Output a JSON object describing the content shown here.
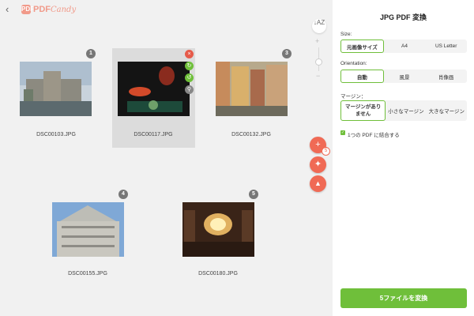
{
  "header": {
    "back_icon": "chevron-left-icon",
    "logo_mark": "PDF",
    "logo_text": "PDF",
    "logo_text_italic": "Candy",
    "brand_color": "#f19a8a"
  },
  "toolbar": {
    "sort_glyph": "↓AZ",
    "zoom_plus": "+",
    "zoom_minus": "−",
    "zoom_level": 0.5
  },
  "side_actions": [
    {
      "name": "add-file",
      "glyph": "+",
      "count": "5"
    },
    {
      "name": "dropbox",
      "glyph": "✦"
    },
    {
      "name": "google-drive",
      "glyph": "▲"
    }
  ],
  "files": [
    {
      "index": "1",
      "name": "DSC00103.JPG"
    },
    {
      "index": "2",
      "name": "DSC00117.JPG"
    },
    {
      "index": "3",
      "name": "DSC00132.JPG"
    },
    {
      "index": "4",
      "name": "DSC00155.JPG"
    },
    {
      "index": "5",
      "name": "DSC00180.JPG"
    }
  ],
  "file_actions": {
    "delete": "×",
    "rotate_right": "↻",
    "rotate_left": "↺",
    "zoom": "⚲"
  },
  "panel": {
    "title": "JPG PDF 変換",
    "size_label": "Size:",
    "size_options": [
      "元画像サイズ",
      "A4",
      "US Letter"
    ],
    "orientation_label": "Orientation:",
    "orientation_options": [
      "自動",
      "風景",
      "肖像画"
    ],
    "margin_label": "マージン：",
    "margin_options": [
      "マージンがありません",
      "小さなマージン",
      "大きなマージン"
    ],
    "merge_checked": true,
    "merge_label": "1つの PDF に結合する",
    "convert_label": "5ファイルを変換",
    "accent_color": "#6fbf3a"
  }
}
